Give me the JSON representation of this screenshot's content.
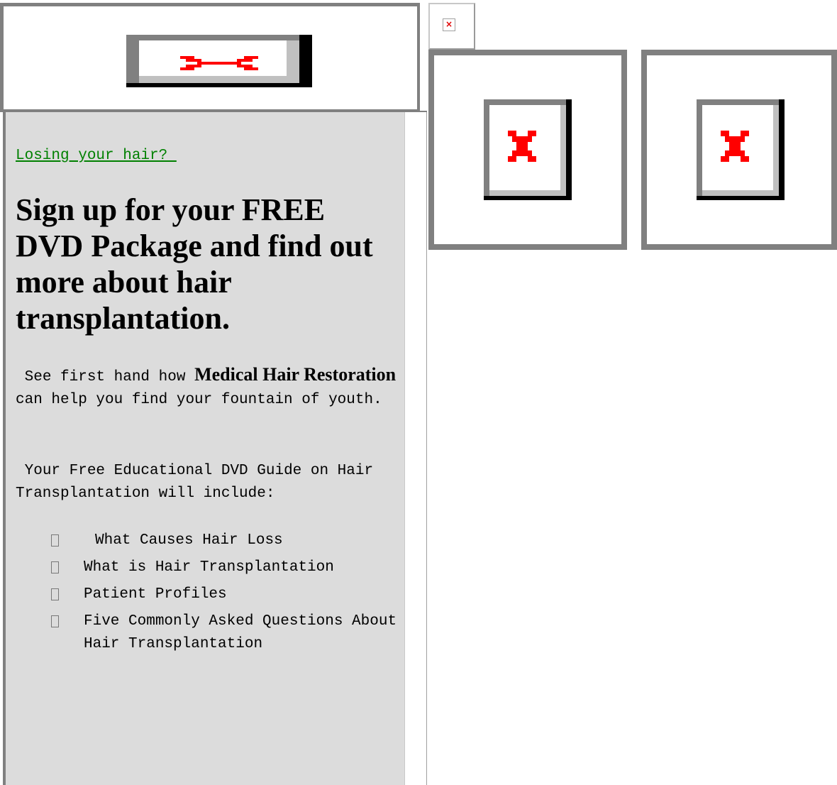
{
  "ad": {
    "link": "Losing your hair? ",
    "heading": "Sign up for your FREE DVD Package and find out more about hair transplantation.",
    "para1_before": " See first hand how ",
    "para1_bold": "Medical Hair Restoration",
    "para1_after": " can help you find your fountain of youth.",
    "para2": " Your Free Educational DVD Guide on Hair Transplantation will include:",
    "list": [
      "What Causes Hair Loss",
      "What is Hair Transplantation",
      "Patient Profiles",
      "Five Commonly Asked Questions About Hair Transplantation"
    ]
  },
  "icons": {
    "broken_image_glyph": "×"
  },
  "colors": {
    "link": "#008000",
    "panel_bg": "#dcdcdc",
    "frame_border": "#808080",
    "broken_red": "#ff0000"
  }
}
